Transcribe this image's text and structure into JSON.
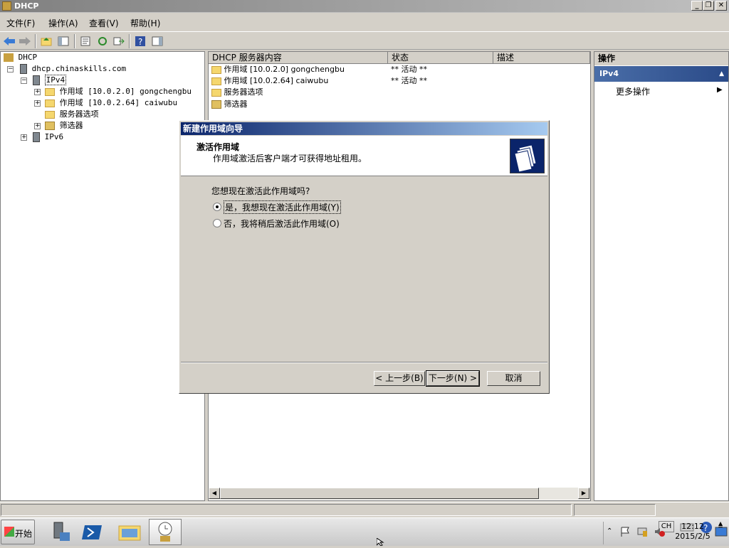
{
  "window": {
    "title": "DHCP"
  },
  "menu": [
    "文件(F)",
    "操作(A)",
    "查看(V)",
    "帮助(H)"
  ],
  "tree": {
    "root": "DHCP",
    "server": "dhcp.chinaskills.com",
    "ipv4": "IPv4",
    "scope1": "作用域 [10.0.2.0] gongchengbu",
    "scope2": "作用域 [10.0.2.64] caiwubu",
    "server_options": "服务器选项",
    "filters": "筛选器",
    "ipv6": "IPv6"
  },
  "list": {
    "columns": [
      "DHCP 服务器内容",
      "状态",
      "描述"
    ],
    "rows": [
      {
        "name": "作用域 [10.0.2.0] gongchengbu",
        "status": "** 活动 **"
      },
      {
        "name": "作用域 [10.0.2.64] caiwubu",
        "status": "** 活动 **"
      },
      {
        "name": "服务器选项",
        "status": ""
      },
      {
        "name": "筛选器",
        "status": ""
      }
    ]
  },
  "actions": {
    "header": "操作",
    "section": "IPv4",
    "more": "更多操作"
  },
  "dialog": {
    "title": "新建作用域向导",
    "heading": "激活作用域",
    "subheading": "作用域激活后客户端才可获得地址租用。",
    "question": "您想现在激活此作用域吗?",
    "option_yes": "是，我想现在激活此作用域(Y)",
    "option_no": "否，我将稍后激活此作用域(O)",
    "back": "< 上一步(B)",
    "next": "下一步(N) >",
    "cancel": "取消"
  },
  "taskbar": {
    "start": "开始",
    "lang": "CH",
    "time": "12:12",
    "date": "2015/2/5"
  }
}
